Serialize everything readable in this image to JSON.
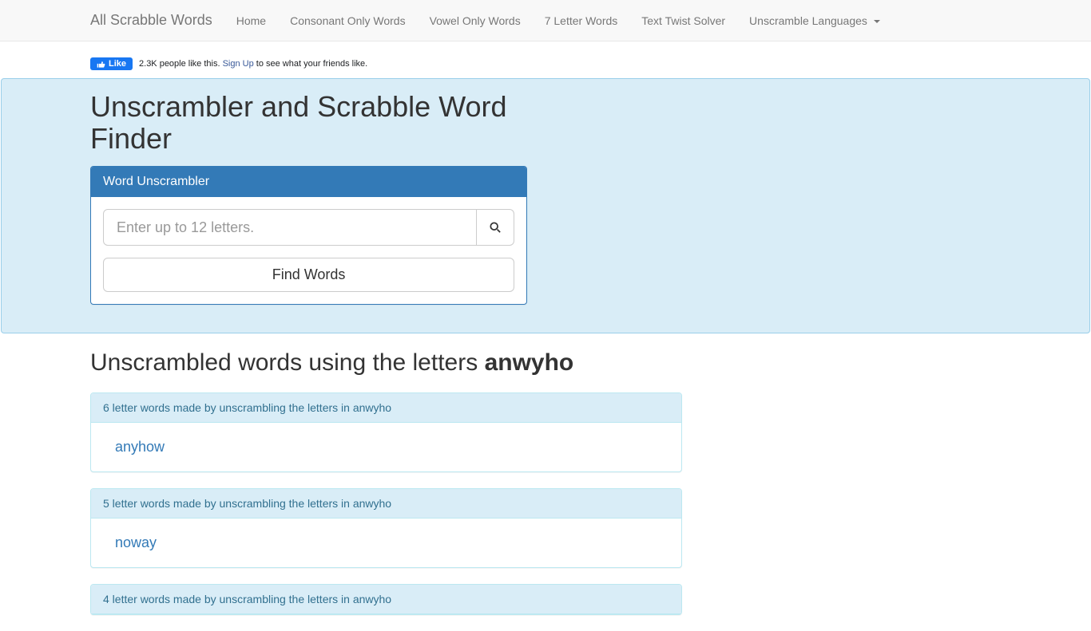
{
  "nav": {
    "brand": "All Scrabble Words",
    "items": [
      "Home",
      "Consonant Only Words",
      "Vowel Only Words",
      "7 Letter Words",
      "Text Twist Solver",
      "Unscramble Languages"
    ]
  },
  "fb": {
    "like_label": "Like",
    "text_prefix": "2.3K people like this. ",
    "signup": "Sign Up",
    "text_suffix": " to see what your friends like."
  },
  "hero": {
    "title": "Unscrambler and Scrabble Word Finder",
    "panel_title": "Word Unscrambler",
    "placeholder": "Enter up to 12 letters.",
    "button": "Find Words"
  },
  "results": {
    "title_prefix": "Unscrambled words using the letters ",
    "letters": "anwyho",
    "groups": [
      {
        "heading": "6 letter words made by unscrambling the letters in anwyho",
        "words": [
          "anyhow"
        ]
      },
      {
        "heading": "5 letter words made by unscrambling the letters in anwyho",
        "words": [
          "noway"
        ]
      },
      {
        "heading": "4 letter words made by unscrambling the letters in anwyho",
        "words": []
      }
    ]
  }
}
